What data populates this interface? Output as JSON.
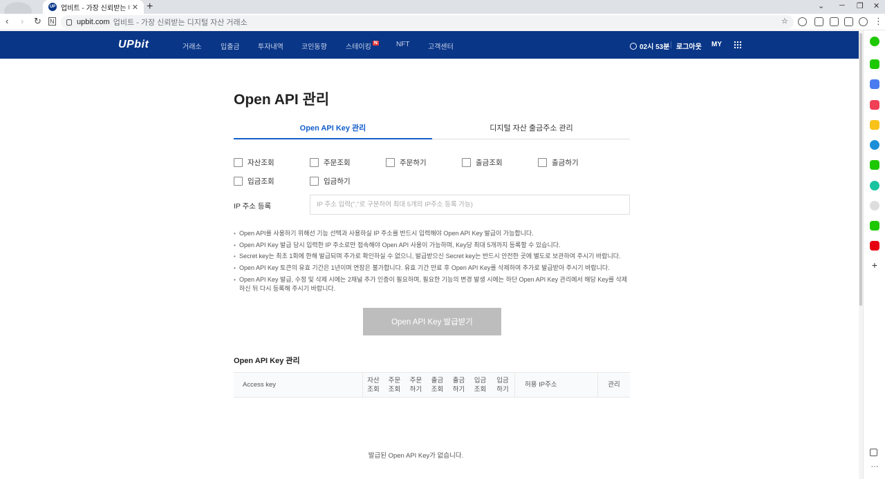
{
  "browser": {
    "tab_title": "업비트 - 가장 신뢰받는 디지털",
    "tab_favicon": "UP",
    "new_tab": "+",
    "url_host": "upbit.com",
    "url_title": "업비트 - 가장 신뢰받는 디지털 자산 거래소"
  },
  "gnb": {
    "logo": "UPbit",
    "menu": [
      "거래소",
      "입출금",
      "투자내역",
      "코인동향",
      "스테이킹",
      "NFT",
      "고객센터"
    ],
    "new_badge": "N",
    "timer": "02시 53분",
    "logout": "로그아웃",
    "my": "MY",
    "brand_color": "#093687"
  },
  "page": {
    "title": "Open API 관리",
    "tabs": [
      "Open API Key 관리",
      "디지털 자산 출금주소 관리"
    ],
    "active_tab_color": "#115dcb",
    "permissions": [
      "자산조회",
      "주문조회",
      "주문하기",
      "출금조회",
      "출금하기",
      "입금조회",
      "입금하기"
    ],
    "ip_label": "IP 주소 등록",
    "ip_placeholder": "IP 주소 입력(\",\"로 구분하여 최대 5개의 IP주소 등록 가능)",
    "notes": [
      "Open API를 사용하기 위해선 기능 선택과 사용하실 IP 주소를 반드시 입력해야 Open API Key 발급이 가능합니다.",
      "Open API Key 발급 당시 입력한 IP 주소로만 접속해야 Open API 사용이 가능하며, Key당 최대 5개까지 등록할 수 있습니다.",
      "Secret key는 최초 1회에 한해 발급되며 추가로 확인하실 수 없으니, 발급받으신 Secret key는 반드시 안전한 곳에 별도로 보관하여 주시기 바랍니다.",
      "Open API Key 토큰의 유효 기간은 1년이며 연장은 불가합니다. 유효 기간 만료 후 Open API Key를 삭제하여 추가로 발급받아 주시기 바랍니다.",
      "Open API Key 발급, 수정 및 삭제 시에는 2채널 추가 인증이 필요하며, 필요한 기능의 변경 발생 시에는 하단 Open API Key 관리에서 해당 Key를 삭제하신 뒤 다시 등록해 주시기 바랍니다."
    ],
    "issue_button": "Open API Key 발급받기",
    "section_title": "Open API Key 관리",
    "table_headers": [
      "Access key",
      "자산\n조회",
      "주문\n조회",
      "주문\n하기",
      "출금\n조회",
      "출금\n하기",
      "입금\n조회",
      "입금\n하기",
      "허용 IP주소",
      "관리"
    ],
    "empty_message": "발급된 Open API Key가 없습니다."
  },
  "sidebar_icons": [
    "green-circle-icon",
    "green-chat-icon",
    "calendar-icon",
    "pocket-icon",
    "star-icon",
    "edge-icon",
    "green-square-icon",
    "play-icon",
    "avatar-icon",
    "green-tag-icon",
    "red-logo-icon",
    "add-icon",
    "external-link-icon",
    "more-icon"
  ]
}
